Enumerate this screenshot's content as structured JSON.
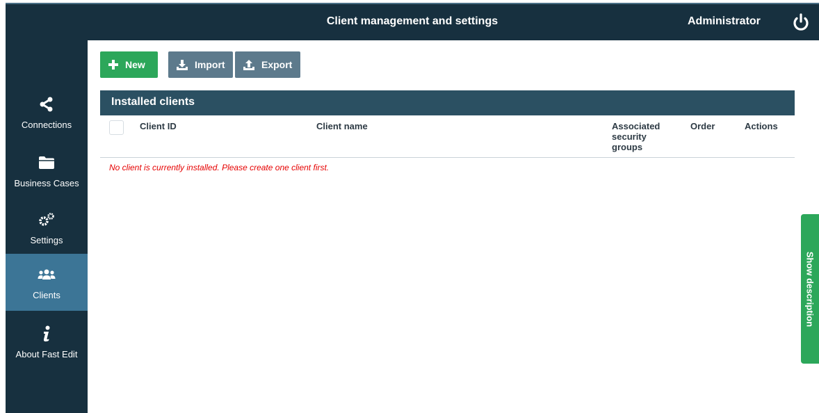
{
  "header": {
    "title": "Client management and settings",
    "user": "Administrator",
    "power_icon": "power-icon"
  },
  "sidebar": {
    "items": [
      {
        "label": "Connections",
        "icon": "share-icon",
        "active": false
      },
      {
        "label": "Business Cases",
        "icon": "folder-icon",
        "active": false
      },
      {
        "label": "Settings",
        "icon": "gears-icon",
        "active": false
      },
      {
        "label": "Clients",
        "icon": "users-icon",
        "active": true
      },
      {
        "label": "About Fast Edit",
        "icon": "info-icon",
        "active": false
      }
    ]
  },
  "toolbar": {
    "new_label": "New",
    "import_label": "Import",
    "export_label": "Export"
  },
  "panel": {
    "title": "Installed clients",
    "columns": {
      "client_id": "Client ID",
      "client_name": "Client name",
      "security_groups": "Associated security groups",
      "order": "Order",
      "actions": "Actions"
    },
    "empty_message": "No client is currently installed. Please create one client first."
  },
  "side_tab": {
    "label": "Show description"
  },
  "colors": {
    "dark_navy": "#17303f",
    "active_nav": "#3c7596",
    "panel_header": "#2b5062",
    "green": "#2ca75a",
    "gray_button": "#5d7a8c",
    "error_red": "#e60000"
  }
}
